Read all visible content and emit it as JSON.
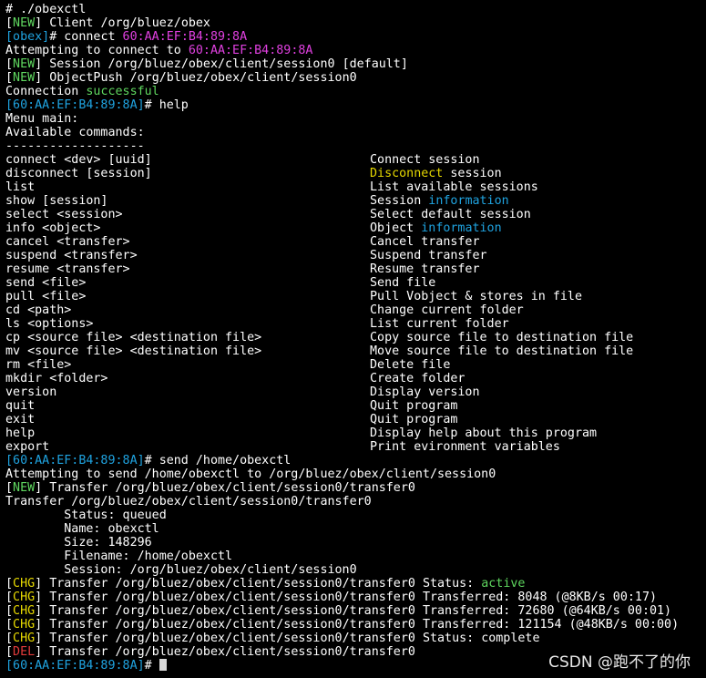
{
  "colors": {
    "background": "#000000",
    "text": "#ffffff",
    "green": "#5fd75f",
    "cyan": "#1fa3e0",
    "magenta": "#e040e0",
    "yellow": "#e6d800",
    "red": "#e23a3a"
  },
  "lines": [
    [
      {
        "t": "# ./obexctl",
        "c": "white"
      }
    ],
    [
      {
        "t": "[",
        "c": "white"
      },
      {
        "t": "NEW",
        "c": "green"
      },
      {
        "t": "] Client /org/bluez/obex",
        "c": "white"
      }
    ],
    [
      {
        "t": "[obex]",
        "c": "cyan"
      },
      {
        "t": "# connect ",
        "c": "white"
      },
      {
        "t": "60:AA:EF:B4:89:8A",
        "c": "magenta"
      }
    ],
    [
      {
        "t": "Attempting to connect to ",
        "c": "white"
      },
      {
        "t": "60:AA:EF:B4:89:8A",
        "c": "magenta"
      }
    ],
    [
      {
        "t": "[",
        "c": "white"
      },
      {
        "t": "NEW",
        "c": "green"
      },
      {
        "t": "] Session /org/bluez/obex/client/session0 [default]",
        "c": "white"
      }
    ],
    [
      {
        "t": "[",
        "c": "white"
      },
      {
        "t": "NEW",
        "c": "green"
      },
      {
        "t": "] ObjectPush /org/bluez/obex/client/session0",
        "c": "white"
      }
    ],
    [
      {
        "t": "Connection ",
        "c": "white"
      },
      {
        "t": "successful",
        "c": "green"
      }
    ],
    [
      {
        "t": "[60:AA:EF:B4:89:8A]",
        "c": "cyan"
      },
      {
        "t": "# help",
        "c": "white"
      }
    ],
    [
      {
        "t": "Menu main:",
        "c": "white"
      }
    ],
    [
      {
        "t": "Available commands:",
        "c": "white"
      }
    ],
    [
      {
        "t": "-------------------",
        "c": "white"
      }
    ],
    {
      "left": "connect <dev> [uuid]",
      "right": [
        {
          "t": "Connect session",
          "c": "white"
        }
      ]
    },
    {
      "left": "disconnect [session]",
      "right": [
        {
          "t": "Disconnect",
          "c": "yellow"
        },
        {
          "t": " session",
          "c": "white"
        }
      ]
    },
    {
      "left": "list",
      "right": [
        {
          "t": "List available sessions",
          "c": "white"
        }
      ]
    },
    {
      "left": "show [session]",
      "right": [
        {
          "t": "Session ",
          "c": "white"
        },
        {
          "t": "information",
          "c": "cyan"
        }
      ]
    },
    {
      "left": "select <session>",
      "right": [
        {
          "t": "Select default session",
          "c": "white"
        }
      ]
    },
    {
      "left": "info <object>",
      "right": [
        {
          "t": "Object ",
          "c": "white"
        },
        {
          "t": "information",
          "c": "cyan"
        }
      ]
    },
    {
      "left": "cancel <transfer>",
      "right": [
        {
          "t": "Cancel transfer",
          "c": "white"
        }
      ]
    },
    {
      "left": "suspend <transfer>",
      "right": [
        {
          "t": "Suspend transfer",
          "c": "white"
        }
      ]
    },
    {
      "left": "resume <transfer>",
      "right": [
        {
          "t": "Resume transfer",
          "c": "white"
        }
      ]
    },
    {
      "left": "send <file>",
      "right": [
        {
          "t": "Send file",
          "c": "white"
        }
      ]
    },
    {
      "left": "pull <file>",
      "right": [
        {
          "t": "Pull Vobject & stores in file",
          "c": "white"
        }
      ]
    },
    {
      "left": "cd <path>",
      "right": [
        {
          "t": "Change current folder",
          "c": "white"
        }
      ]
    },
    {
      "left": "ls <options>",
      "right": [
        {
          "t": "List current folder",
          "c": "white"
        }
      ]
    },
    {
      "left": "cp <source file> <destination file>",
      "right": [
        {
          "t": "Copy source file to destination file",
          "c": "white"
        }
      ]
    },
    {
      "left": "mv <source file> <destination file>",
      "right": [
        {
          "t": "Move source file to destination file",
          "c": "white"
        }
      ]
    },
    {
      "left": "rm <file>",
      "right": [
        {
          "t": "Delete file",
          "c": "white"
        }
      ]
    },
    {
      "left": "mkdir <folder>",
      "right": [
        {
          "t": "Create folder",
          "c": "white"
        }
      ]
    },
    {
      "left": "version",
      "right": [
        {
          "t": "Display version",
          "c": "white"
        }
      ]
    },
    {
      "left": "quit",
      "right": [
        {
          "t": "Quit program",
          "c": "white"
        }
      ]
    },
    {
      "left": "exit",
      "right": [
        {
          "t": "Quit program",
          "c": "white"
        }
      ]
    },
    {
      "left": "help",
      "right": [
        {
          "t": "Display help about this program",
          "c": "white"
        }
      ]
    },
    {
      "left": "export",
      "right": [
        {
          "t": "Print evironment variables",
          "c": "white"
        }
      ]
    },
    [
      {
        "t": "[60:AA:EF:B4:89:8A]",
        "c": "cyan"
      },
      {
        "t": "# send /home/obexctl",
        "c": "white"
      }
    ],
    [
      {
        "t": "Attempting to send /home/obexctl to /org/bluez/obex/client/session0",
        "c": "white"
      }
    ],
    [
      {
        "t": "[",
        "c": "white"
      },
      {
        "t": "NEW",
        "c": "green"
      },
      {
        "t": "] Transfer /org/bluez/obex/client/session0/transfer0",
        "c": "white"
      }
    ],
    [
      {
        "t": "Transfer /org/bluez/obex/client/session0/transfer0",
        "c": "white"
      }
    ],
    [
      {
        "t": "        Status: queued",
        "c": "white"
      }
    ],
    [
      {
        "t": "        Name: obexctl",
        "c": "white"
      }
    ],
    [
      {
        "t": "        Size: 148296",
        "c": "white"
      }
    ],
    [
      {
        "t": "        Filename: /home/obexctl",
        "c": "white"
      }
    ],
    [
      {
        "t": "        Session: /org/bluez/obex/client/session0",
        "c": "white"
      }
    ],
    [
      {
        "t": "[",
        "c": "white"
      },
      {
        "t": "CHG",
        "c": "yellow"
      },
      {
        "t": "] Transfer /org/bluez/obex/client/session0/transfer0 Status: ",
        "c": "white"
      },
      {
        "t": "active",
        "c": "green"
      }
    ],
    [
      {
        "t": "[",
        "c": "white"
      },
      {
        "t": "CHG",
        "c": "yellow"
      },
      {
        "t": "] Transfer /org/bluez/obex/client/session0/transfer0 Transferred: 8048 (@8KB/s 00:17)",
        "c": "white"
      }
    ],
    [
      {
        "t": "[",
        "c": "white"
      },
      {
        "t": "CHG",
        "c": "yellow"
      },
      {
        "t": "] Transfer /org/bluez/obex/client/session0/transfer0 Transferred: 72680 (@64KB/s 00:01)",
        "c": "white"
      }
    ],
    [
      {
        "t": "[",
        "c": "white"
      },
      {
        "t": "CHG",
        "c": "yellow"
      },
      {
        "t": "] Transfer /org/bluez/obex/client/session0/transfer0 Transferred: 121154 (@48KB/s 00:00)",
        "c": "white"
      }
    ],
    [
      {
        "t": "[",
        "c": "white"
      },
      {
        "t": "CHG",
        "c": "yellow"
      },
      {
        "t": "] Transfer /org/bluez/obex/client/session0/transfer0 Status: complete",
        "c": "white"
      }
    ],
    [
      {
        "t": "[",
        "c": "white"
      },
      {
        "t": "DEL",
        "c": "red"
      },
      {
        "t": "] Transfer /org/bluez/obex/client/session0/transfer0",
        "c": "white"
      }
    ],
    [
      {
        "t": "[60:AA:EF:B4:89:8A]",
        "c": "cyan"
      },
      {
        "t": "# ",
        "c": "white"
      }
    ]
  ],
  "watermark": "CSDN @跑不了的你"
}
